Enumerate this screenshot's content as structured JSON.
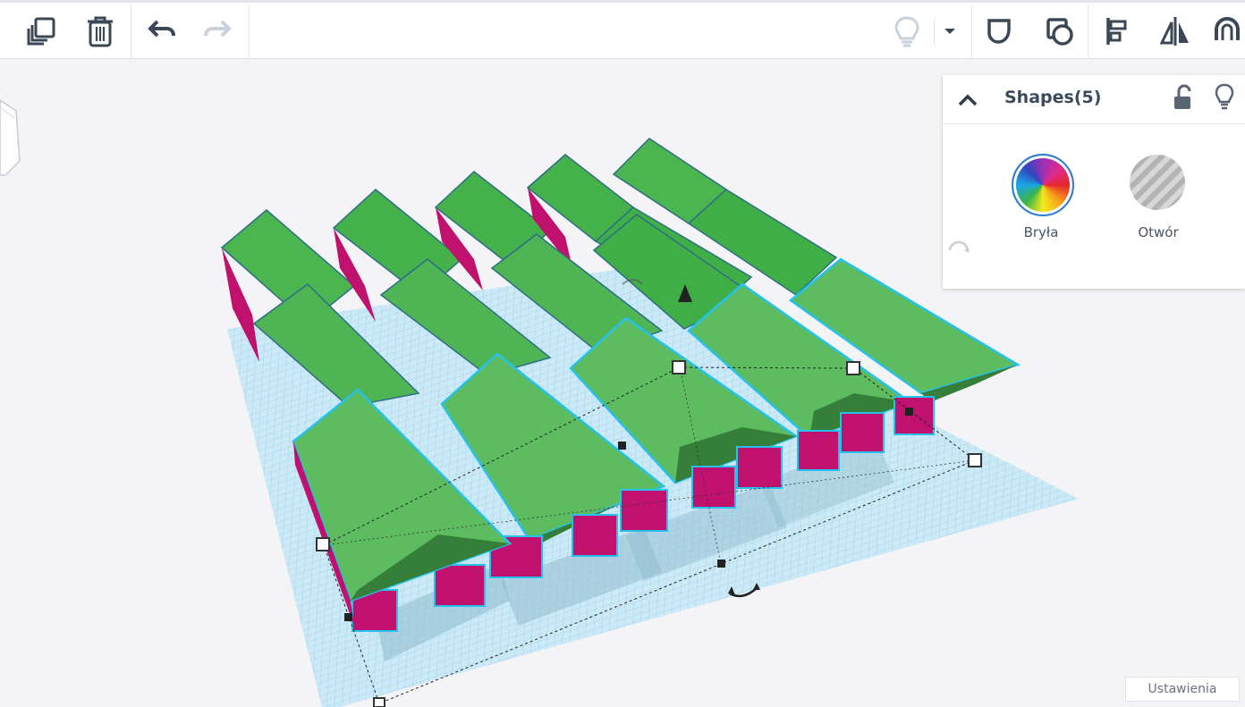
{
  "toolbar": {
    "copy": "copy-icon",
    "delete": "trash-icon",
    "undo": "undo-icon",
    "redo": "redo-icon",
    "light": "lightbulb-icon",
    "dropdown": "chevron-down-icon",
    "group": "group-icon",
    "ungroup": "ungroup-icon",
    "align": "align-icon",
    "mirror": "mirror-icon",
    "magnet": "magnet-icon"
  },
  "panel": {
    "title": "Shapes(5)",
    "collapse_icon": "chevron-up-icon",
    "lock_icon": "unlock-icon",
    "light_icon": "lightbulb-icon",
    "solid_label": "Bryła",
    "hole_label": "Otwór"
  },
  "settings_label": "Ustawienia",
  "colors": {
    "roof": "#3fae46",
    "wall": "#c0116e",
    "grid": "#a9d8ef",
    "selection": "#26c2ee"
  }
}
